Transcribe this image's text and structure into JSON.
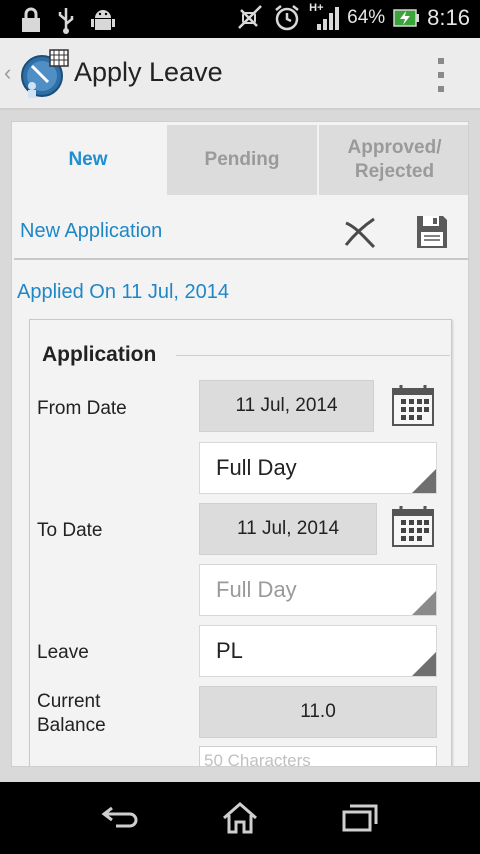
{
  "status_bar": {
    "battery_percent": "64%",
    "time": "8:16",
    "signal_type": "H+",
    "icons": [
      "lock-icon",
      "usb-icon",
      "android-icon",
      "mute-icon",
      "alarm-icon",
      "signal-icon",
      "battery-charging-icon"
    ]
  },
  "action_bar": {
    "title": "Apply Leave",
    "back_glyph": "‹"
  },
  "tabs": [
    {
      "label": "New",
      "active": true
    },
    {
      "label": "Pending",
      "active": false
    },
    {
      "label": "Approved/ Rejected",
      "active": false
    }
  ],
  "sub_header": {
    "title": "New Application",
    "actions": [
      "cancel-icon",
      "save-icon"
    ]
  },
  "applied_on": "Applied On 11 Jul, 2014",
  "application": {
    "section_title": "Application",
    "from_date": {
      "label": "From Date",
      "value": "11 Jul, 2014",
      "duration": "Full Day"
    },
    "to_date": {
      "label": "To Date",
      "value": "11 Jul, 2014",
      "duration": "Full Day"
    },
    "leave": {
      "label": "Leave",
      "value": "PL"
    },
    "current_balance": {
      "label": "Current Balance",
      "value": "11.0"
    },
    "remarks_placeholder": "50 Characters"
  },
  "colors": {
    "accent": "#1f8fd2",
    "tab_inactive_bg": "#dcdcdc",
    "card_bg": "#f3f3f3"
  },
  "nav_bar": [
    "back-icon",
    "home-icon",
    "recent-apps-icon"
  ]
}
